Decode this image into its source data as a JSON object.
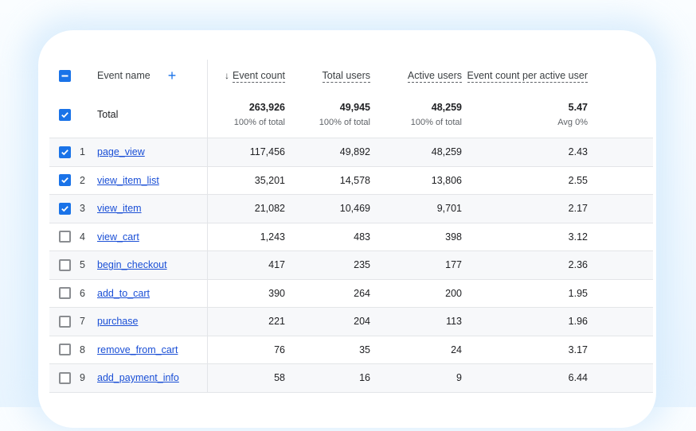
{
  "header": {
    "event_name": "Event name",
    "add_icon": "+",
    "sort_arrow": "↓",
    "event_count": "Event count",
    "total_users": "Total users",
    "active_users": "Active users",
    "event_count_per_active_user": "Event count per active user"
  },
  "total": {
    "label": "Total",
    "event_count": "263,926",
    "event_count_sub": "100% of total",
    "total_users": "49,945",
    "total_users_sub": "100% of total",
    "active_users": "48,259",
    "active_users_sub": "100% of total",
    "per_user": "5.47",
    "per_user_sub": "Avg 0%"
  },
  "rows": [
    {
      "num": "1",
      "name": "page_view",
      "event_count": "117,456",
      "total_users": "49,892",
      "active_users": "48,259",
      "per_user": "2.43",
      "checked": true
    },
    {
      "num": "2",
      "name": "view_item_list",
      "event_count": "35,201",
      "total_users": "14,578",
      "active_users": "13,806",
      "per_user": "2.55",
      "checked": true
    },
    {
      "num": "3",
      "name": "view_item",
      "event_count": "21,082",
      "total_users": "10,469",
      "active_users": "9,701",
      "per_user": "2.17",
      "checked": true
    },
    {
      "num": "4",
      "name": "view_cart",
      "event_count": "1,243",
      "total_users": "483",
      "active_users": "398",
      "per_user": "3.12",
      "checked": false
    },
    {
      "num": "5",
      "name": "begin_checkout",
      "event_count": "417",
      "total_users": "235",
      "active_users": "177",
      "per_user": "2.36",
      "checked": false
    },
    {
      "num": "6",
      "name": "add_to_cart",
      "event_count": "390",
      "total_users": "264",
      "active_users": "200",
      "per_user": "1.95",
      "checked": false
    },
    {
      "num": "7",
      "name": "purchase",
      "event_count": "221",
      "total_users": "204",
      "active_users": "113",
      "per_user": "1.96",
      "checked": false
    },
    {
      "num": "8",
      "name": "remove_from_cart",
      "event_count": "76",
      "total_users": "35",
      "active_users": "24",
      "per_user": "3.17",
      "checked": false
    },
    {
      "num": "9",
      "name": "add_payment_info",
      "event_count": "58",
      "total_users": "16",
      "active_users": "9",
      "per_user": "6.44",
      "checked": false
    }
  ],
  "colors": {
    "accent": "#1a73e8",
    "link": "#1a4fd6"
  }
}
